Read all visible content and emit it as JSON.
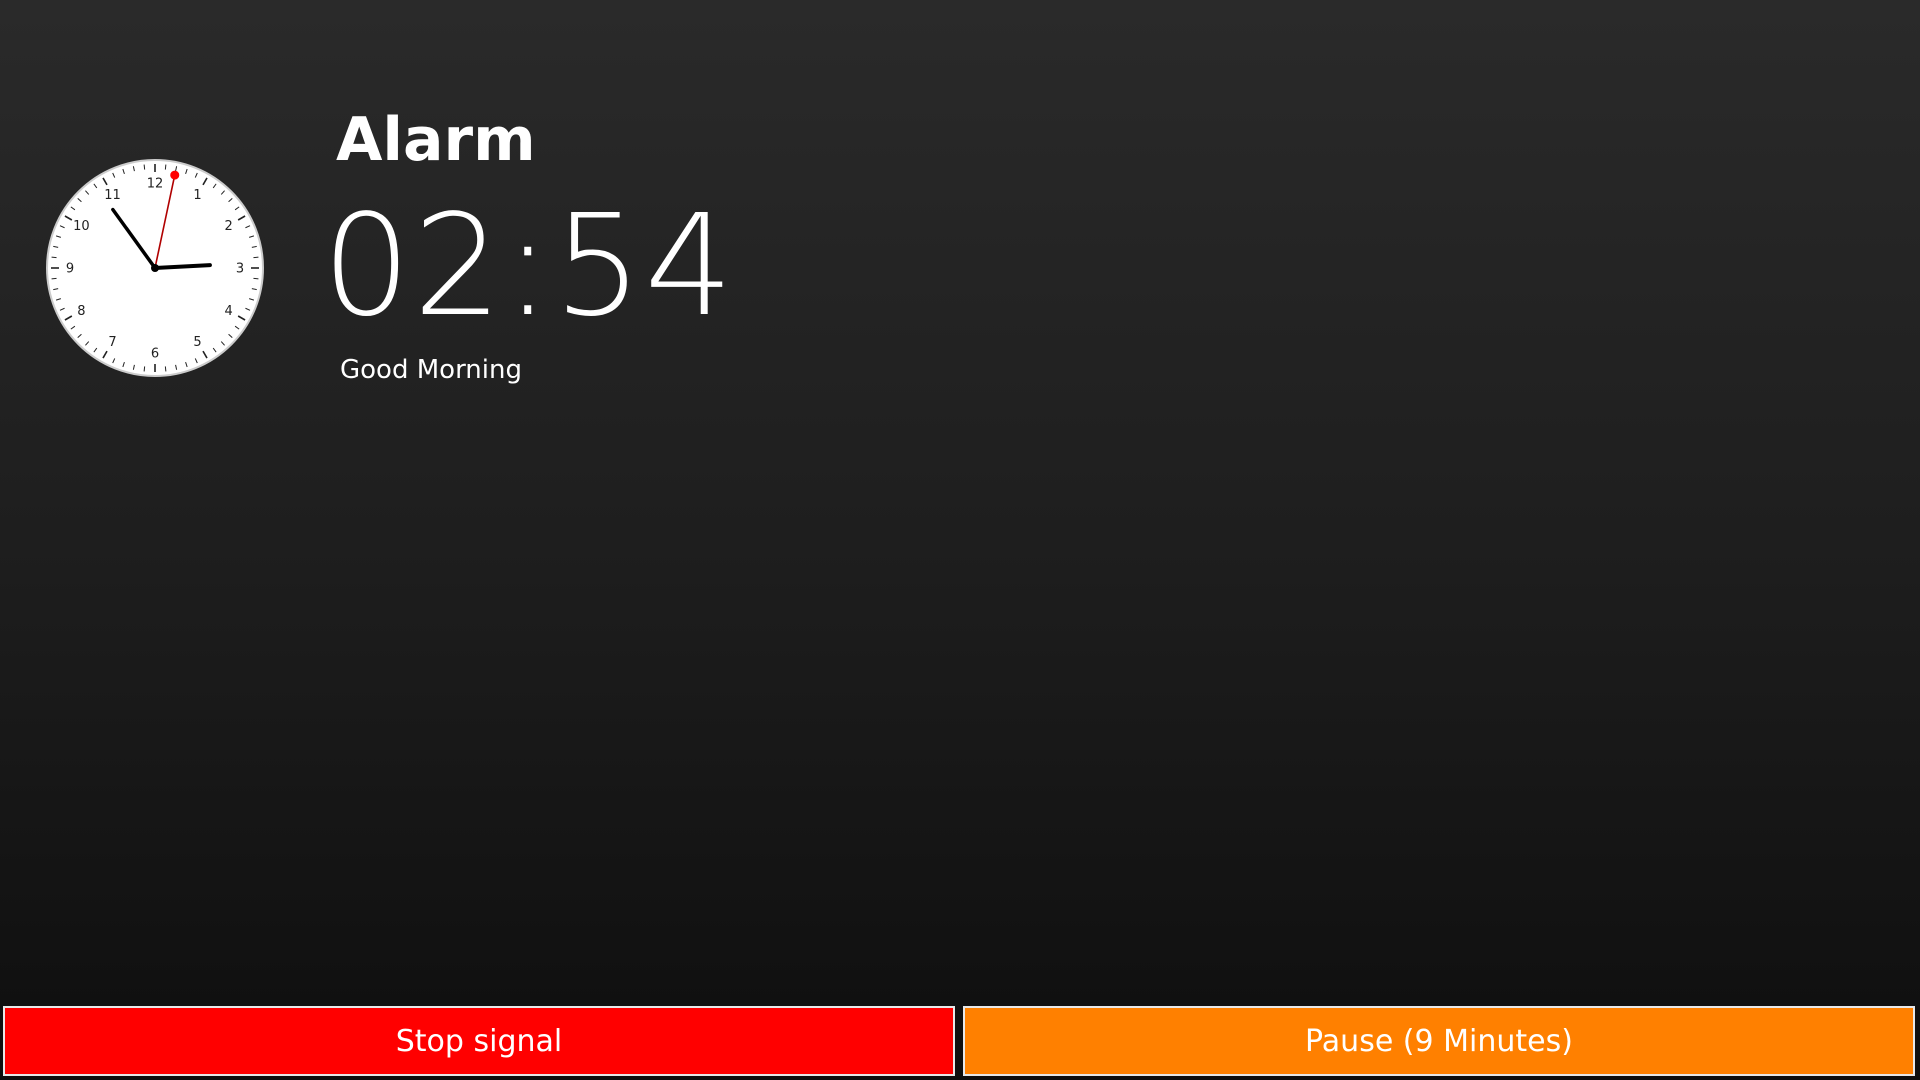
{
  "alarm": {
    "title": "Alarm",
    "time": "02:54",
    "message": "Good Morning"
  },
  "clock": {
    "numerals": [
      "12",
      "1",
      "2",
      "3",
      "4",
      "5",
      "6",
      "7",
      "8",
      "9",
      "10",
      "11"
    ],
    "hour": 2,
    "minute": 54,
    "second": 2,
    "face_color": "#ffffff",
    "hand_color": "#000000",
    "second_hand_color": "#cc0000"
  },
  "buttons": {
    "stop": {
      "label": "Stop signal",
      "color": "#ff0000"
    },
    "pause": {
      "label": "Pause (9 Minutes)",
      "color": "#ff8000"
    }
  }
}
